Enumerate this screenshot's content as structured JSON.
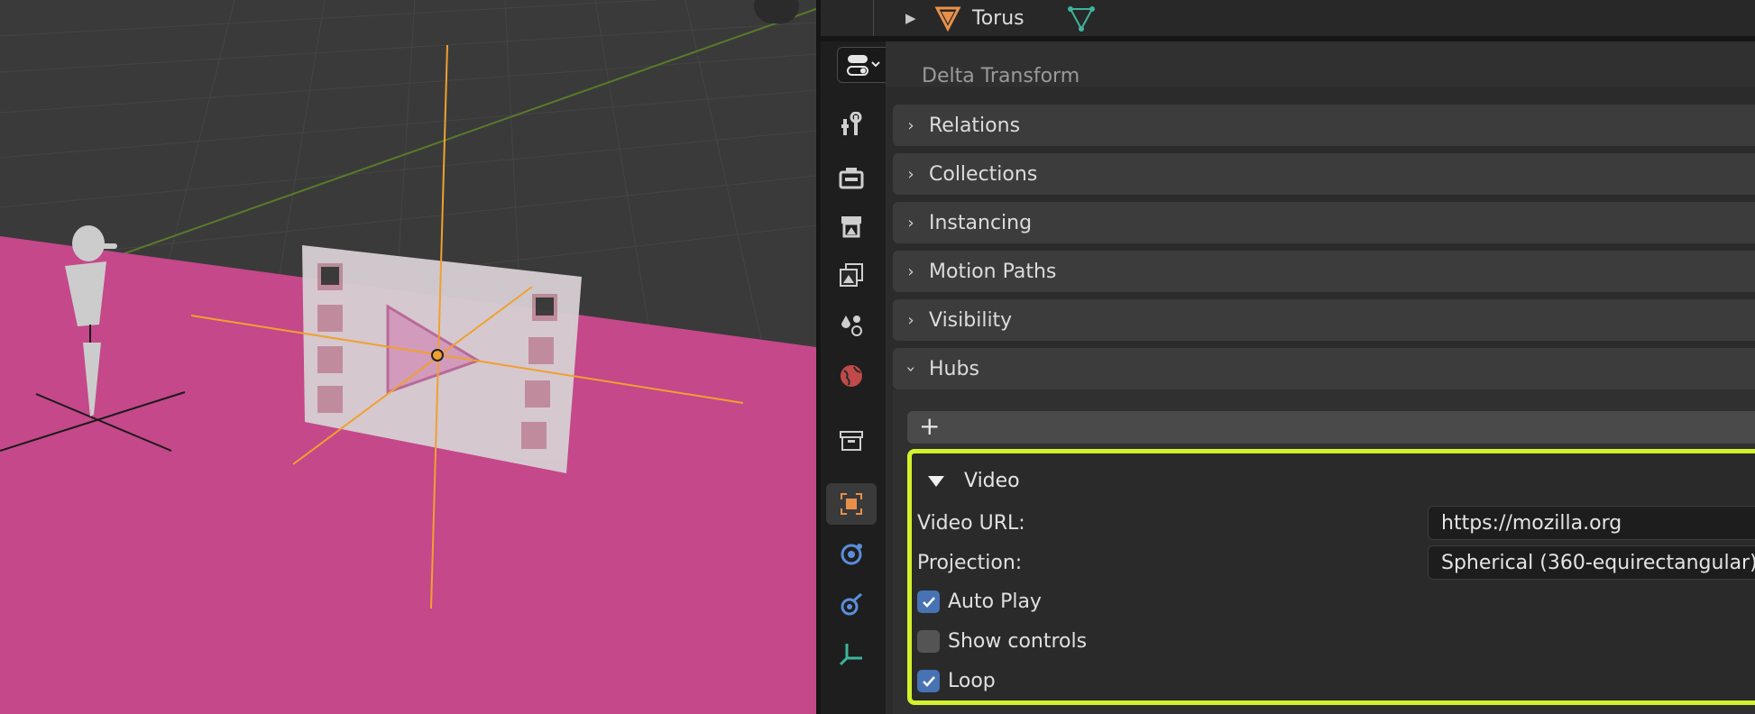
{
  "outliner": {
    "object_name": "Torus"
  },
  "properties": {
    "cut_off_panel_label": "Delta Transform",
    "panels": [
      {
        "label": "Relations",
        "expanded": false
      },
      {
        "label": "Collections",
        "expanded": false
      },
      {
        "label": "Instancing",
        "expanded": false
      },
      {
        "label": "Motion Paths",
        "expanded": false
      },
      {
        "label": "Visibility",
        "expanded": false
      },
      {
        "label": "Hubs",
        "expanded": true
      }
    ],
    "hubs": {
      "add_button": "+",
      "video": {
        "title": "Video",
        "video_url_label": "Video URL:",
        "video_url_value": "https://mozilla.org",
        "projection_label": "Projection:",
        "projection_value": "Spherical (360-equirectangular)",
        "auto_play_label": "Auto Play",
        "auto_play_checked": true,
        "show_controls_label": "Show controls",
        "show_controls_checked": false,
        "loop_label": "Loop",
        "loop_checked": true
      }
    }
  },
  "tabs": [
    {
      "icon": "tool-icon"
    },
    {
      "icon": "render-icon"
    },
    {
      "icon": "output-icon"
    },
    {
      "icon": "view-layer-icon"
    },
    {
      "icon": "scene-icon"
    },
    {
      "icon": "world-icon"
    },
    {
      "icon": "collection-icon"
    },
    {
      "icon": "object-icon",
      "active": true
    },
    {
      "icon": "physics-icon"
    },
    {
      "icon": "constraint-icon"
    },
    {
      "icon": "data-icon"
    }
  ],
  "colors": {
    "highlight": "#d4f22b",
    "floor": "#c4488a",
    "checkbox_on": "#4772b3",
    "origin_axis": "#f0a030"
  }
}
